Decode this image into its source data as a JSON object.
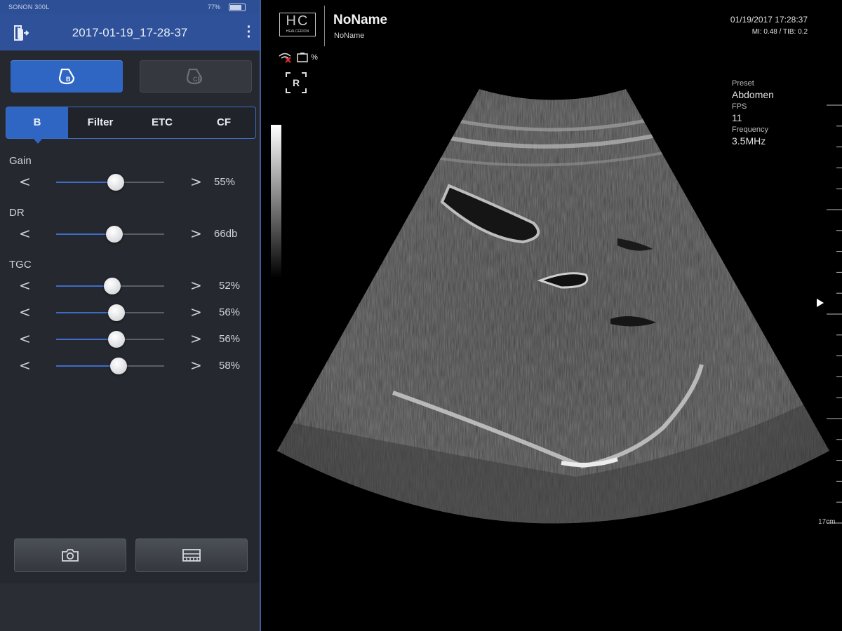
{
  "status_bar": {
    "device": "SONON 300L",
    "battery": "77%"
  },
  "header": {
    "title": "2017-01-19_17-28-37"
  },
  "modes": {
    "b_label": "B",
    "cf_label": "CF"
  },
  "tabs": [
    {
      "label": "B",
      "active": true
    },
    {
      "label": "Filter",
      "active": false
    },
    {
      "label": "ETC",
      "active": false
    },
    {
      "label": "CF",
      "active": false
    }
  ],
  "controls": {
    "gain": {
      "label": "Gain",
      "value": "55%",
      "level": 0.55
    },
    "dr": {
      "label": "DR",
      "value": "66db",
      "level": 0.54
    },
    "tgc": {
      "label": "TGC",
      "rows": [
        {
          "value": "52%",
          "level": 0.52
        },
        {
          "value": "56%",
          "level": 0.56
        },
        {
          "value": "56%",
          "level": 0.56
        },
        {
          "value": "58%",
          "level": 0.58
        }
      ]
    },
    "decrement_symbol": "<",
    "increment_symbol": ">"
  },
  "image": {
    "logo": "HC",
    "logo_sub": "HEALCERION",
    "patient_name": "NoName",
    "patient_id": "NoName",
    "datetime": "01/19/2017 17:28:37",
    "mi_tib": "MI: 0.48 / TIB: 0.2",
    "battery_symbol": "%",
    "orientation_marker": "R",
    "preset_label": "Preset",
    "preset_value": "Abdomen",
    "fps_label": "FPS",
    "fps_value": "11",
    "frequency_label": "Frequency",
    "frequency_value": "3.5MHz",
    "depth": "17cm"
  },
  "colors": {
    "accent": "#2f66c4",
    "panel": "#25282e",
    "titlebar": "#2e5199"
  },
  "icons": {
    "exit": "exit-door-icon",
    "kebab": "more-vert-icon",
    "b_mode": "b-mode-icon",
    "cf_mode": "cf-mode-icon",
    "capture": "camera-icon",
    "save": "cine-save-icon"
  }
}
